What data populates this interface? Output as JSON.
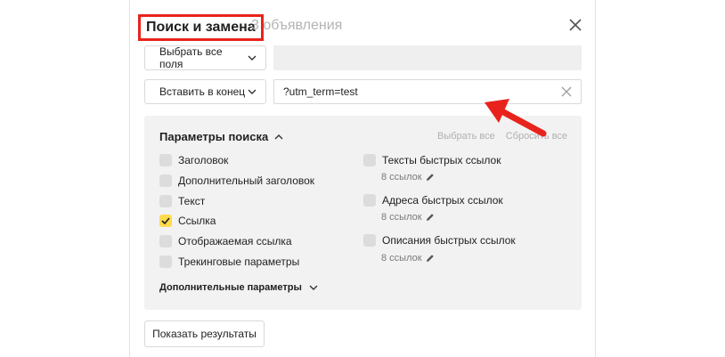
{
  "dialog": {
    "title": "Поиск и замена",
    "subtitle": "3 объявления",
    "close_icon": "close-icon"
  },
  "fields_select": {
    "value": "Выбрать все поля",
    "icon": "chevron-down-icon"
  },
  "mode_select": {
    "value": "Вставить в конец",
    "icon": "chevron-down-icon"
  },
  "text_input": {
    "value": "?utm_term=test",
    "clear_icon": "clear-icon"
  },
  "search_params": {
    "title": "Параметры поиска",
    "toggle_icon": "chevron-up-icon",
    "select_all": "Выбрать все",
    "reset_all": "Сбросить все",
    "left_options": [
      {
        "label": "Заголовок",
        "checked": false
      },
      {
        "label": "Дополнительный заголовок",
        "checked": false
      },
      {
        "label": "Текст",
        "checked": false
      },
      {
        "label": "Ссылка",
        "checked": true
      },
      {
        "label": "Отображаемая ссылка",
        "checked": false
      },
      {
        "label": "Трекинговые параметры",
        "checked": false
      }
    ],
    "right_options": [
      {
        "label": "Тексты быстрых ссылок",
        "checked": false,
        "count": "8 ссылок"
      },
      {
        "label": "Адреса быстрых ссылок",
        "checked": false,
        "count": "8 ссылок"
      },
      {
        "label": "Описания быстрых ссылок",
        "checked": false,
        "count": "8 ссылок"
      }
    ],
    "more_params": "Дополнительные параметры",
    "more_icon": "chevron-down-icon"
  },
  "show_results_label": "Показать результаты",
  "colors": {
    "highlight_border": "#e8231b",
    "annotation_arrow": "#e8231b",
    "checkbox_checked": "#ffdb4d",
    "panel_bg": "#f2f2f2"
  }
}
